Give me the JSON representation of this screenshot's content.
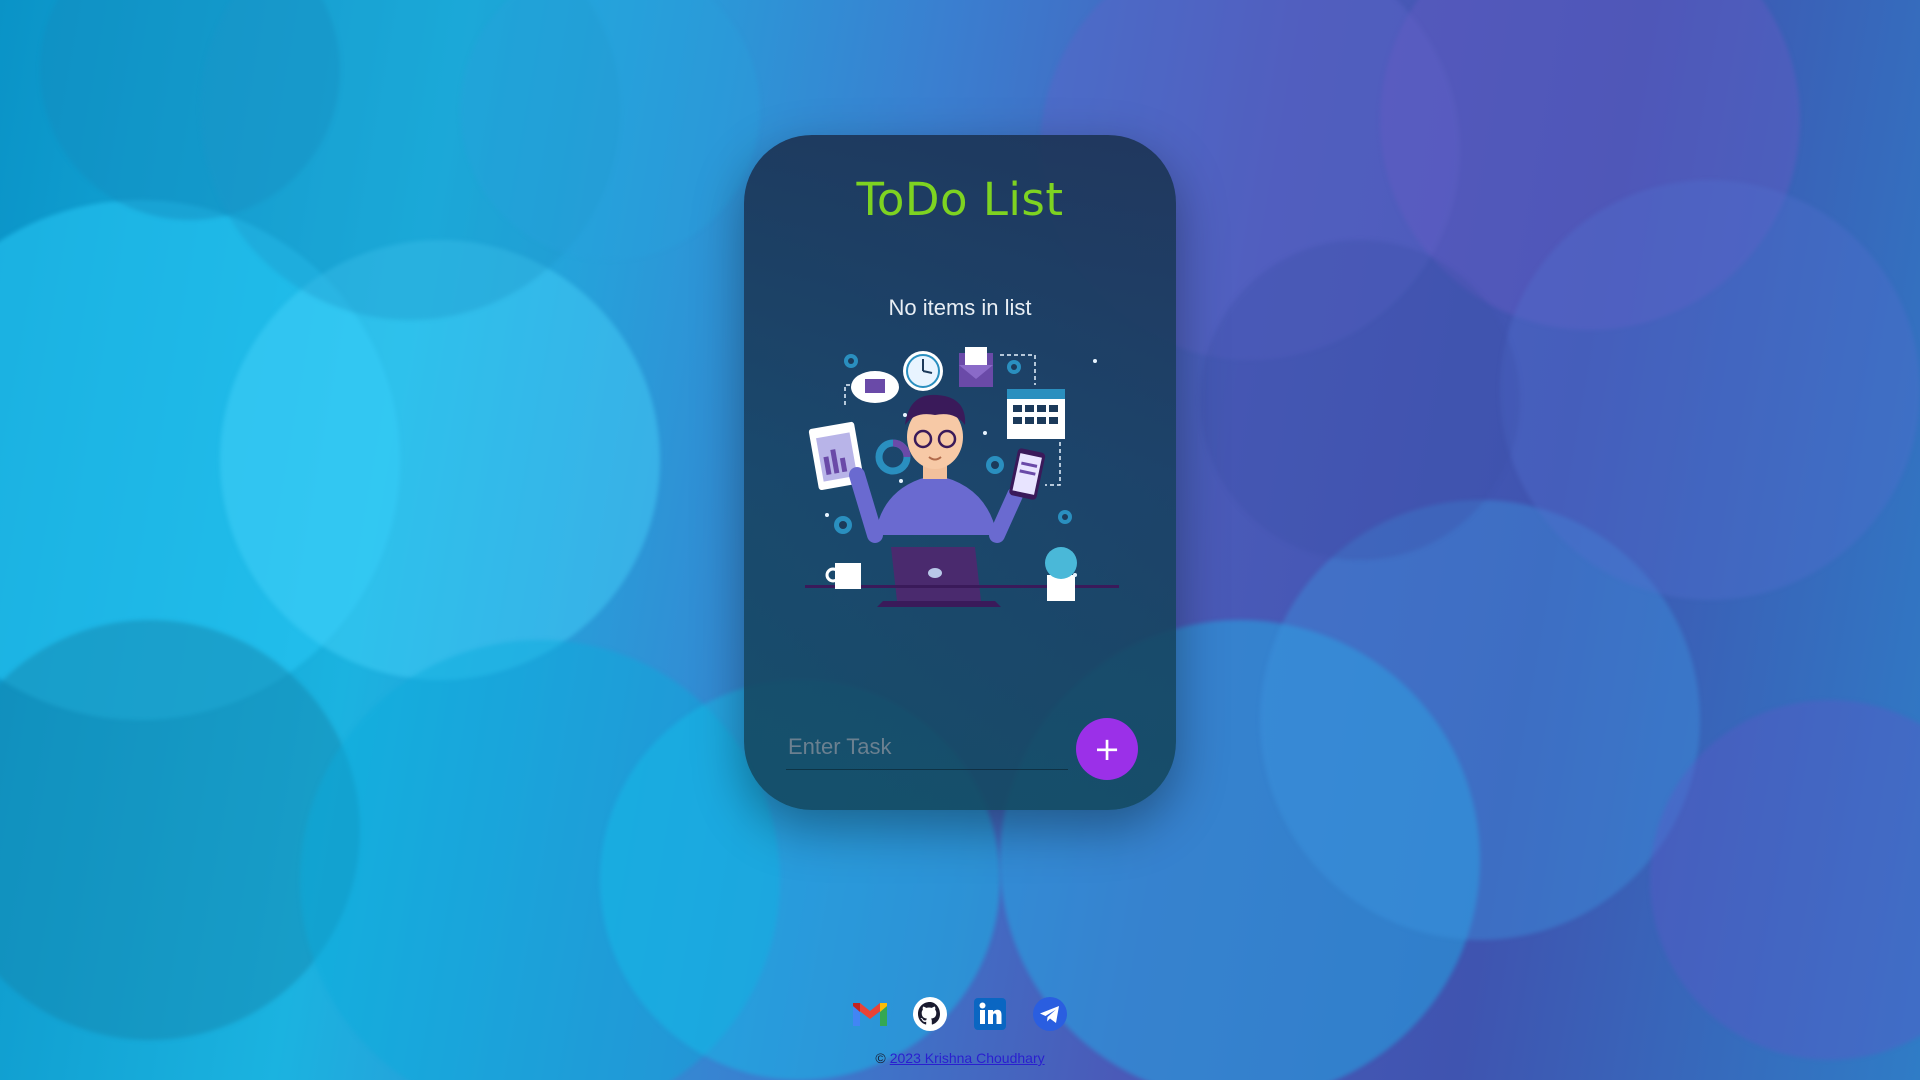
{
  "app": {
    "title": "ToDo List"
  },
  "list": {
    "empty_message": "No items in list",
    "illustration": "person-working-at-desk-illustration"
  },
  "task_input": {
    "placeholder": "Enter Task",
    "value": ""
  },
  "add_button": {
    "label": "+",
    "color": "#9b30e8"
  },
  "social_links": [
    {
      "icon": "gmail-icon"
    },
    {
      "icon": "github-icon"
    },
    {
      "icon": "linkedin-icon"
    },
    {
      "icon": "telegram-icon"
    }
  ],
  "footer": {
    "copyright_symbol": "©",
    "text": "2023 Krishna Choudhary"
  },
  "colors": {
    "title": "#7ed321",
    "accent": "#9b30e8",
    "link": "#2a1fcf"
  }
}
